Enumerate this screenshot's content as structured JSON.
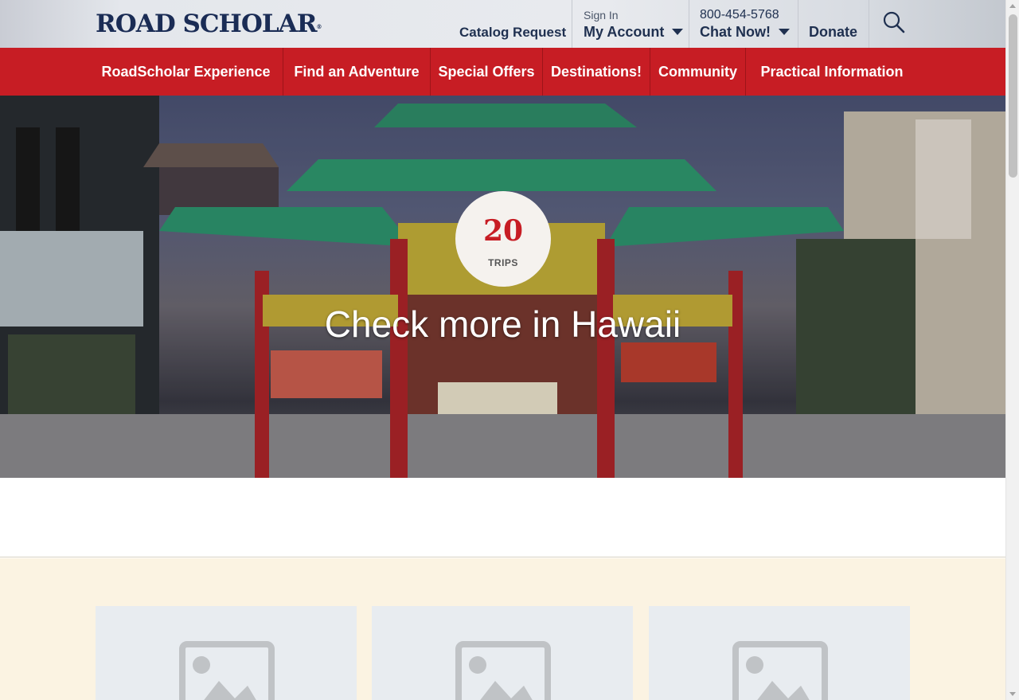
{
  "header": {
    "logo": "ROAD SCHOLAR",
    "logo_mark": "®",
    "catalog_request": "Catalog Request",
    "sign_in": "Sign In",
    "my_account": "My Account",
    "phone": "800-454-5768",
    "chat_now": "Chat Now!",
    "donate": "Donate",
    "search_icon": "search-icon"
  },
  "nav": {
    "items": [
      {
        "label": "RoadScholar Experience"
      },
      {
        "label": "Find an Adventure"
      },
      {
        "label": "Special Offers"
      },
      {
        "label": "Destinations!"
      },
      {
        "label": "Community"
      },
      {
        "label": "Practical Information"
      }
    ]
  },
  "hero": {
    "trips_count": "20",
    "trips_label": "TRIPS",
    "title": "Check more in Hawaii"
  },
  "cards": [
    {
      "icon": "image-placeholder-icon"
    },
    {
      "icon": "image-placeholder-icon"
    },
    {
      "icon": "image-placeholder-icon"
    }
  ],
  "colors": {
    "brand_red": "#c71d24",
    "brand_navy": "#1a2c55",
    "cream": "#fbf3e2"
  }
}
